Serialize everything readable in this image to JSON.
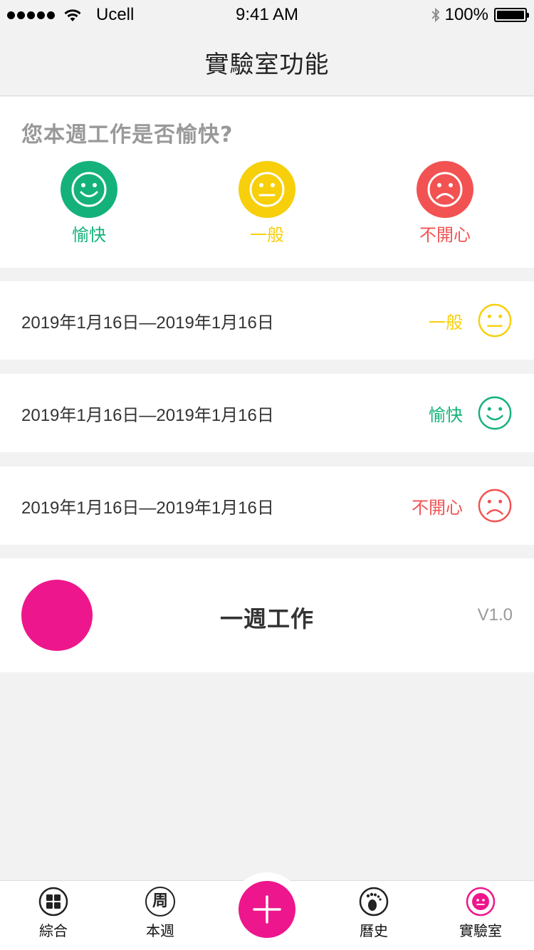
{
  "status_bar": {
    "carrier": "Ucell",
    "time": "9:41 AM",
    "battery": "100%"
  },
  "nav": {
    "title": "實驗室功能"
  },
  "mood_prompt": {
    "question": "您本週工作是否愉快?",
    "options": [
      {
        "label": "愉快",
        "icon": "happy-face-icon",
        "color": "#14b27a"
      },
      {
        "label": "一般",
        "icon": "neutral-face-icon",
        "color": "#f7cf0a"
      },
      {
        "label": "不開心",
        "icon": "sad-face-icon",
        "color": "#f25252"
      }
    ]
  },
  "records": [
    {
      "date_range": "2019年1月16日—2019年1月16日",
      "mood": "一般",
      "icon": "neutral-face-icon",
      "color": "#f7cf0a"
    },
    {
      "date_range": "2019年1月16日—2019年1月16日",
      "mood": "愉快",
      "icon": "happy-face-icon",
      "color": "#14b27a"
    },
    {
      "date_range": "2019年1月16日—2019年1月16日",
      "mood": "不開心",
      "icon": "sad-face-icon",
      "color": "#f25252"
    }
  ],
  "app_info": {
    "name": "一週工作",
    "version": "V1.0",
    "logo_color": "#ee168c"
  },
  "tab_bar": {
    "items": [
      {
        "label": "綜合",
        "icon": "grid-icon"
      },
      {
        "label": "本週",
        "icon": "week-icon",
        "glyph": "周"
      },
      {
        "label": "",
        "icon": "plus-icon"
      },
      {
        "label": "曆史",
        "icon": "footprint-icon"
      },
      {
        "label": "實驗室",
        "icon": "lab-face-icon",
        "active": true
      }
    ],
    "accent_color": "#ee168c"
  }
}
